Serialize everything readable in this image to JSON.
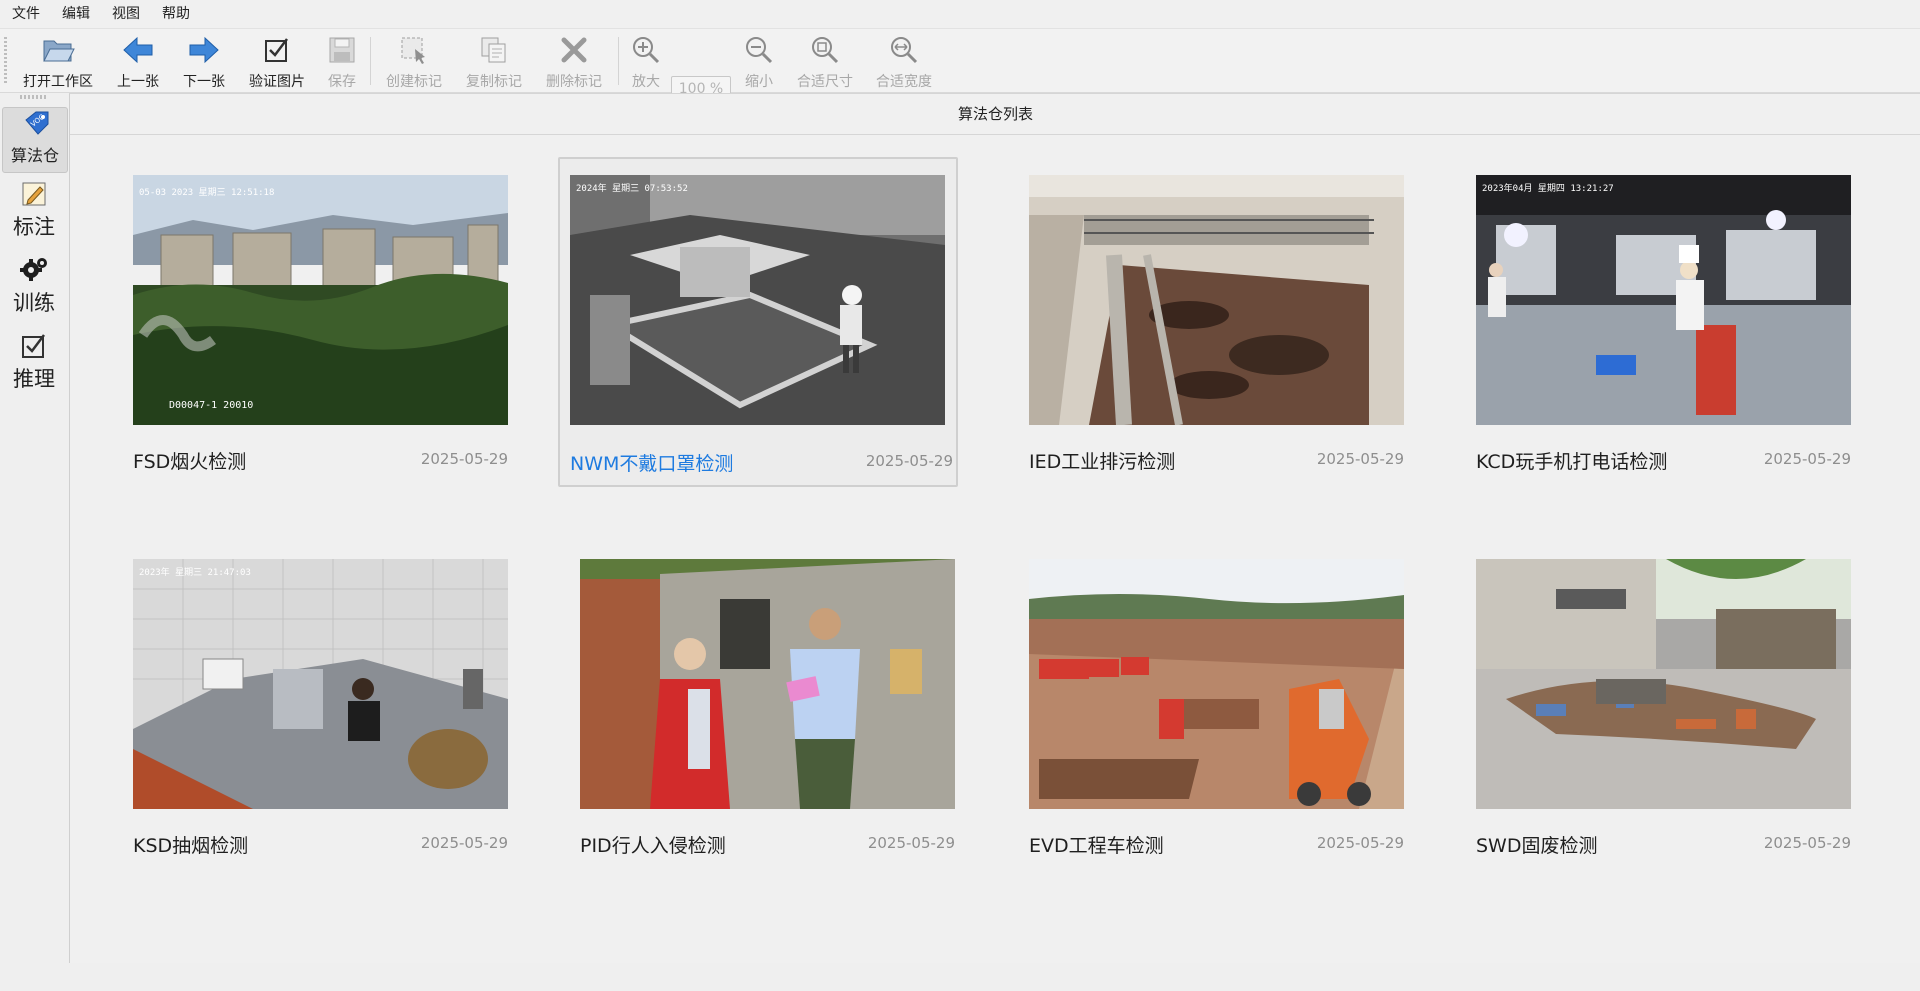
{
  "menubar": {
    "items": [
      "文件",
      "编辑",
      "视图",
      "帮助"
    ]
  },
  "toolbar": {
    "open_workspace": "打开工作区",
    "prev": "上一张",
    "next": "下一张",
    "verify": "验证图片",
    "save": "保存",
    "create_mark": "创建标记",
    "copy_mark": "复制标记",
    "delete_mark": "删除标记",
    "zoom_in": "放大",
    "zoom_level": "100 %",
    "zoom_out": "缩小",
    "fit_size": "合适尺寸",
    "fit_width": "合适宽度"
  },
  "sidebar": {
    "items": [
      {
        "label": "算法仓",
        "icon": "voc-tag-icon",
        "active": true
      },
      {
        "label": "标注",
        "icon": "annotate-pencil-icon",
        "active": false
      },
      {
        "label": "训练",
        "icon": "gears-icon",
        "active": false
      },
      {
        "label": "推理",
        "icon": "checkbox-icon",
        "active": false
      }
    ]
  },
  "panel": {
    "title": "算法仓列表"
  },
  "models": [
    {
      "name": "FSD烟火检测",
      "date": "2025-05-29",
      "selected": false,
      "scene": "city-forest-smoke"
    },
    {
      "name": "NWM不戴口罩检测",
      "date": "2025-05-29",
      "selected": true,
      "scene": "kitchen-grayscale"
    },
    {
      "name": "IED工业排污检测",
      "date": "2025-05-29",
      "selected": false,
      "scene": "sewage-tank"
    },
    {
      "name": "KCD玩手机打电话检测",
      "date": "2025-05-29",
      "selected": false,
      "scene": "restaurant-kitchen"
    },
    {
      "name": "KSD抽烟检测",
      "date": "2025-05-29",
      "selected": false,
      "scene": "kitchen-smoking"
    },
    {
      "name": "PID行人入侵检测",
      "date": "2025-05-29",
      "selected": false,
      "scene": "two-people-village"
    },
    {
      "name": "EVD工程车检测",
      "date": "2025-05-29",
      "selected": false,
      "scene": "construction-site"
    },
    {
      "name": "SWD固废检测",
      "date": "2025-05-29",
      "selected": false,
      "scene": "solid-waste"
    }
  ]
}
